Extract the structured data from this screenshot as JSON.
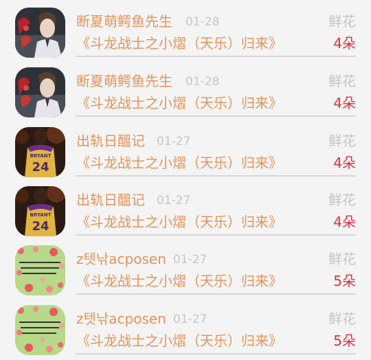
{
  "rows": [
    {
      "user": "断夏萌鳄鱼先生",
      "date": "01-28",
      "gift_type": "鲜花",
      "book": "《斗龙战士之小熠（天乐）归来》",
      "count": "4朵",
      "avatar": "boy-portrait-avatar"
    },
    {
      "user": "断夏萌鳄鱼先生",
      "date": "01-28",
      "gift_type": "鲜花",
      "book": "《斗龙战士之小熠（天乐）归来》",
      "count": "4朵",
      "avatar": "boy-portrait-avatar"
    },
    {
      "user": "出轨日醞记",
      "date": "01-27",
      "gift_type": "鲜花",
      "book": "《斗龙战士之小熠（天乐）归来》",
      "count": "4朵",
      "avatar": "basketball-jersey-avatar"
    },
    {
      "user": "出轨日醞记",
      "date": "01-27",
      "gift_type": "鲜花",
      "book": "《斗龙战士之小熠（天乐）归来》",
      "count": "4朵",
      "avatar": "basketball-jersey-avatar"
    },
    {
      "user": "z텟낚acposen",
      "date": "01-27",
      "gift_type": "鲜花",
      "book": "《斗龙战士之小熠（天乐）归来》",
      "count": "5朵",
      "avatar": "floral-text-avatar"
    },
    {
      "user": "z텟낚acposen",
      "date": "01-27",
      "gift_type": "鲜花",
      "book": "《斗龙战士之小熠（天乐）归来》",
      "count": "5朵",
      "avatar": "floral-text-avatar"
    }
  ]
}
